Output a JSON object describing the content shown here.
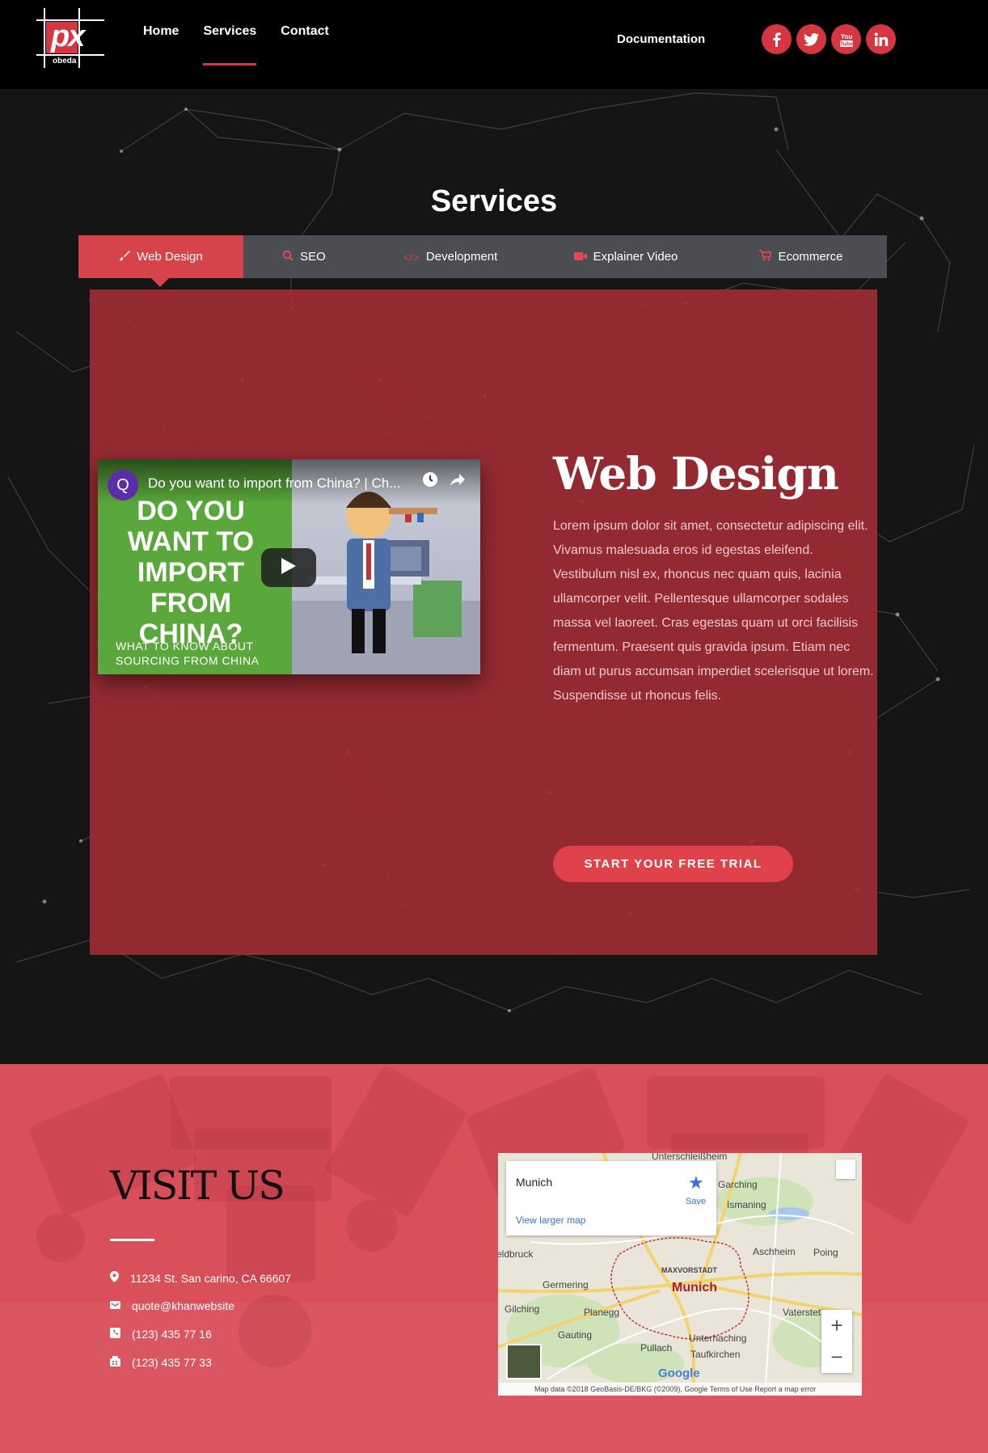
{
  "header": {
    "logo": {
      "letters": "px",
      "caption": "obeda"
    },
    "nav": [
      {
        "label": "Home",
        "active": false
      },
      {
        "label": "Services",
        "active": true
      },
      {
        "label": "Contact",
        "active": false
      }
    ],
    "documentation": "Documentation",
    "social_icons": [
      "facebook-icon",
      "twitter-icon",
      "youtube-icon",
      "linkedin-icon"
    ],
    "accent_color": "#d6363f"
  },
  "services": {
    "title": "Services",
    "tabs": [
      {
        "label": "Web Design",
        "icon": "brush-icon",
        "active": true
      },
      {
        "label": "SEO",
        "icon": "search-icon",
        "active": false
      },
      {
        "label": "Development",
        "icon": "code-icon",
        "active": false
      },
      {
        "label": "Explainer Video",
        "icon": "video-camera-icon",
        "active": false
      },
      {
        "label": "Ecommerce",
        "icon": "cart-icon",
        "active": false
      }
    ],
    "video": {
      "avatar_letter": "Q",
      "title": "Do you want to import from China? | Ch...",
      "headline": "DO YOU WANT TO IMPORT FROM CHINA?",
      "subline": "WHAT TO KNOW ABOUT SOURCING FROM CHINA"
    },
    "panel_title": "Web Design",
    "panel_body": "Lorem ipsum dolor sit amet, consectetur adipiscing elit. Vivamus malesuada eros id egestas eleifend. Vestibulum nisl ex, rhoncus nec quam quis, lacinia ullamcorper velit. Pellentesque ullamcorper sodales massa vel laoreet. Cras egestas quam ut orci facilisis fermentum. Praesent quis gravida ipsum. Etiam nec diam ut purus accumsan imperdiet scelerisque ut lorem. Suspendisse ut rhoncus felis.",
    "cta": "START YOUR FREE TRIAL"
  },
  "visit": {
    "title": "VISIT US",
    "contacts": [
      {
        "icon": "map-pin-icon",
        "text": "11234 St. San carino, CA 66607"
      },
      {
        "icon": "envelope-icon",
        "text": "quote@khanwebsite"
      },
      {
        "icon": "phone-icon",
        "text": "(123) 435 77 16"
      },
      {
        "icon": "fax-icon",
        "text": "(123) 435 77 33"
      }
    ],
    "map": {
      "place": "Munich",
      "save": "Save",
      "larger_map": "View larger map",
      "city_label": "Munich",
      "labels": [
        "Unterschleißheim",
        "Garching",
        "Ismaning",
        "Aschheim",
        "Poing",
        "Germering",
        "Gilching",
        "Planegg",
        "Gauting",
        "Pullach",
        "Unterhaching",
        "Taufkirchen",
        "Vaterstetten",
        "MAXVORSTADT",
        "eldbruck"
      ],
      "footer": "Map data ©2018 GeoBasis-DE/BKG (©2009), Google   Terms of Use   Report a map error",
      "google": "Google"
    }
  }
}
